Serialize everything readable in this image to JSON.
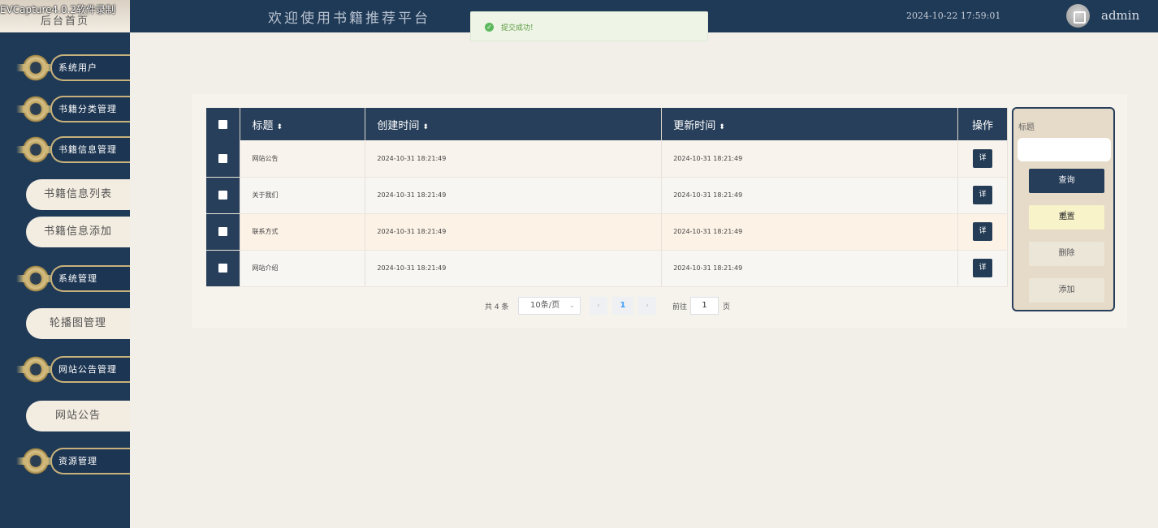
{
  "watermark": "EVCapture4.0.2软件录制",
  "header": {
    "home_tab": "后台首页",
    "site_title": "欢迎使用书籍推荐平台",
    "datetime": "2024-10-22 17:59:01",
    "username": "admin"
  },
  "toast": {
    "message": "提交成功!"
  },
  "sidebar": {
    "items": [
      {
        "label": "系统用户"
      },
      {
        "label": "书籍分类管理"
      },
      {
        "label": "书籍信息管理"
      },
      {
        "label": "书籍信息列表"
      },
      {
        "label": "书籍信息添加"
      },
      {
        "label": "系统管理"
      },
      {
        "label": "轮播图管理"
      },
      {
        "label": "网站公告管理"
      },
      {
        "label": "网站公告"
      },
      {
        "label": "资源管理"
      }
    ]
  },
  "table": {
    "columns": [
      "标题",
      "创建时间",
      "更新时间",
      "操作"
    ],
    "rows": [
      {
        "title": "网站公告",
        "created": "2024-10-31 18:21:49",
        "updated": "2024-10-31 18:21:49",
        "action": "详"
      },
      {
        "title": "关于我们",
        "created": "2024-10-31 18:21:49",
        "updated": "2024-10-31 18:21:49",
        "action": "详"
      },
      {
        "title": "联系方式",
        "created": "2024-10-31 18:21:49",
        "updated": "2024-10-31 18:21:49",
        "action": "详"
      },
      {
        "title": "网站介绍",
        "created": "2024-10-31 18:21:49",
        "updated": "2024-10-31 18:21:49",
        "action": "详"
      }
    ]
  },
  "pagination": {
    "total": "共 4 条",
    "page_size": "10条/页",
    "current": "1",
    "goto_label": "前往",
    "goto_value": "1",
    "page_suffix": "页"
  },
  "search": {
    "label": "标题",
    "query": "查询",
    "reset": "重置",
    "delete": "删除",
    "add": "添加"
  },
  "colors": {
    "navy": "#1f3a57",
    "gold": "#c8b27b",
    "beige": "#f2efe8"
  }
}
